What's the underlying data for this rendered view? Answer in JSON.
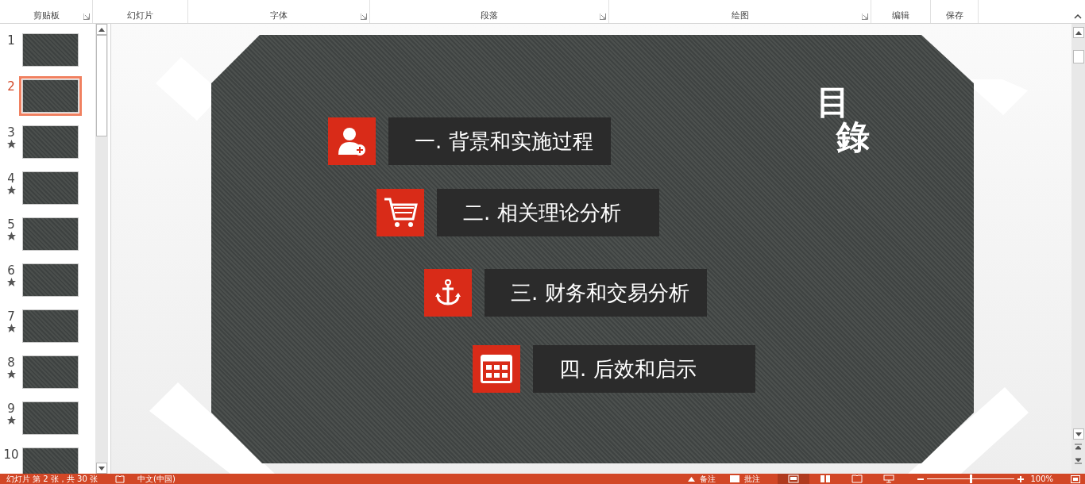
{
  "ribbon": {
    "groups": [
      {
        "label": "剪贴板",
        "launcher": true
      },
      {
        "label": "幻灯片",
        "launcher": false
      },
      {
        "label": "字体",
        "launcher": true
      },
      {
        "label": "段落",
        "launcher": true
      },
      {
        "label": "绘图",
        "launcher": true
      },
      {
        "label": "编辑",
        "launcher": false
      },
      {
        "label": "保存",
        "launcher": false
      }
    ]
  },
  "slides_panel": {
    "slides": [
      {
        "number": "1",
        "selected": false,
        "animated": false
      },
      {
        "number": "2",
        "selected": true,
        "animated": false
      },
      {
        "number": "3",
        "selected": false,
        "animated": true
      },
      {
        "number": "4",
        "selected": false,
        "animated": true
      },
      {
        "number": "5",
        "selected": false,
        "animated": true
      },
      {
        "number": "6",
        "selected": false,
        "animated": true
      },
      {
        "number": "7",
        "selected": false,
        "animated": true
      },
      {
        "number": "8",
        "selected": false,
        "animated": true
      },
      {
        "number": "9",
        "selected": false,
        "animated": true
      },
      {
        "number": "10",
        "selected": false,
        "animated": false
      }
    ]
  },
  "slide": {
    "title_chars": [
      "目",
      "錄"
    ],
    "items": [
      {
        "label": "一. 背景和实施过程",
        "kind": "person"
      },
      {
        "label": "二. 相关理论分析",
        "kind": "cart"
      },
      {
        "label": "三. 财务和交易分析",
        "kind": "anchor"
      },
      {
        "label": "四. 后效和启示",
        "kind": "calendar"
      }
    ]
  },
  "status_bar": {
    "slide_info": "幻灯片 第 2 张，共 30 张",
    "language": "中文(中国)",
    "notes": "备注",
    "comments": "批注",
    "views": [
      {
        "kind": "normal",
        "selected": true
      },
      {
        "kind": "sorter",
        "selected": false
      },
      {
        "kind": "reading",
        "selected": false
      },
      {
        "kind": "slideshow",
        "selected": false
      }
    ],
    "zoom": {
      "level": 0.5
    },
    "zoom_text": "100%"
  }
}
